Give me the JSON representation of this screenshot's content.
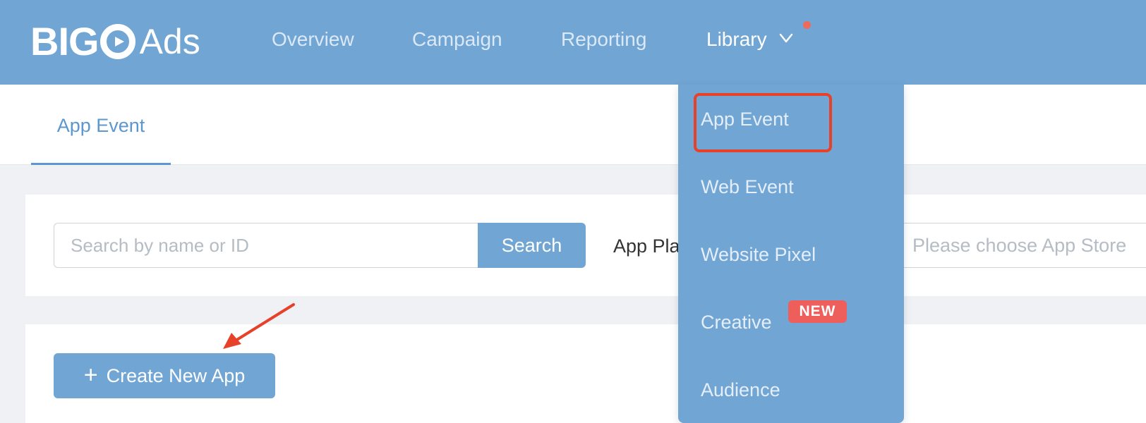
{
  "brand": {
    "logo_text_left": "BIGO",
    "logo_text_right": "Ads"
  },
  "nav": {
    "items": [
      {
        "label": "Overview"
      },
      {
        "label": "Campaign"
      },
      {
        "label": "Reporting"
      },
      {
        "label": "Library"
      }
    ],
    "active": "Library"
  },
  "tabs": [
    {
      "label": "App Event"
    }
  ],
  "filters": {
    "search_placeholder": "Search by name or ID",
    "search_button": "Search",
    "platform_label": "App Pla",
    "store_placeholder": "Please choose App Store"
  },
  "actions": {
    "create_label": "Create New App"
  },
  "dropdown": {
    "items": [
      {
        "label": "App Event"
      },
      {
        "label": "Web Event"
      },
      {
        "label": "Website Pixel"
      },
      {
        "label": "Creative",
        "badge": "NEW"
      },
      {
        "label": "Audience"
      }
    ]
  },
  "colors": {
    "nav_bg": "#71a5d4",
    "accent": "#5d97cf",
    "highlight": "#e8412a",
    "badge": "#ee5f5b"
  }
}
